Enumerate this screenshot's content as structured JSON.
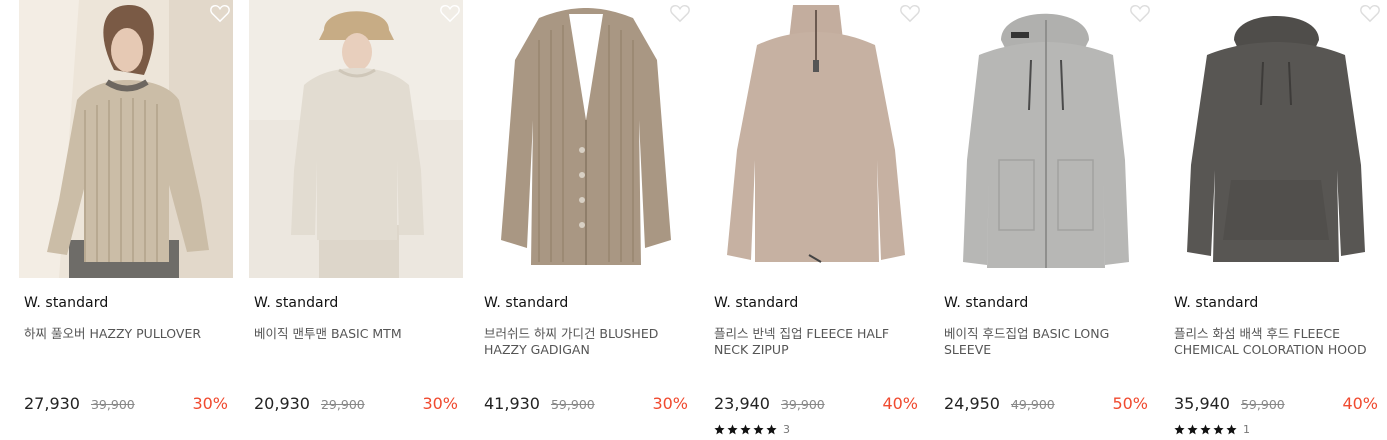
{
  "products": [
    {
      "brand": "W. standard",
      "name": "하찌 풀오버 HAZZY PULLOVER",
      "price": "27,930",
      "original_price": "39,900",
      "discount": "30%",
      "image_icon": "knit-pullover-photo",
      "wishlist_icon": "heart-outline-icon",
      "colors": {
        "bg": "#ece4d8",
        "garment": "#cbbda7"
      }
    },
    {
      "brand": "W. standard",
      "name": "베이직 맨투맨 BASIC MTM",
      "price": "20,930",
      "original_price": "29,900",
      "discount": "30%",
      "image_icon": "sweatshirt-photo",
      "wishlist_icon": "heart-outline-icon",
      "colors": {
        "bg": "#ece7df",
        "garment": "#e2dcd1"
      }
    },
    {
      "brand": "W. standard",
      "name": "브러쉬드 하찌 가디건 BLUSHED HAZZY GADIGAN",
      "price": "41,930",
      "original_price": "59,900",
      "discount": "30%",
      "image_icon": "cardigan-photo",
      "wishlist_icon": "heart-outline-icon",
      "colors": {
        "bg": "#ffffff",
        "garment": "#a99783"
      }
    },
    {
      "brand": "W. standard",
      "name": "플리스 반넥 집업 FLEECE HALF NECK ZIPUP",
      "price": "23,940",
      "original_price": "39,900",
      "discount": "40%",
      "rating": 5,
      "review_count": "3",
      "image_icon": "fleece-zipup-photo",
      "wishlist_icon": "heart-outline-icon",
      "colors": {
        "bg": "#ffffff",
        "garment": "#c6b1a2"
      }
    },
    {
      "brand": "W. standard",
      "name": "베이직 후드집업 BASIC LONG SLEEVE",
      "price": "24,950",
      "original_price": "49,900",
      "discount": "50%",
      "image_icon": "hooded-zipup-photo",
      "wishlist_icon": "heart-outline-icon",
      "colors": {
        "bg": "#ffffff",
        "garment": "#b7b7b5"
      }
    },
    {
      "brand": "W. standard",
      "name": "플리스 화섬 배색 후드 FLEECE CHEMICAL COLORATION HOOD",
      "price": "35,940",
      "original_price": "59,900",
      "discount": "40%",
      "rating": 5,
      "review_count": "1",
      "image_icon": "fleece-hoodie-photo",
      "wishlist_icon": "heart-outline-icon",
      "colors": {
        "bg": "#ffffff",
        "garment": "#585653"
      }
    }
  ],
  "colors": {
    "discount": "#f04a2f",
    "text": "#222222",
    "muted": "#888888",
    "star": "#111111"
  },
  "star_icon": "star-icon"
}
